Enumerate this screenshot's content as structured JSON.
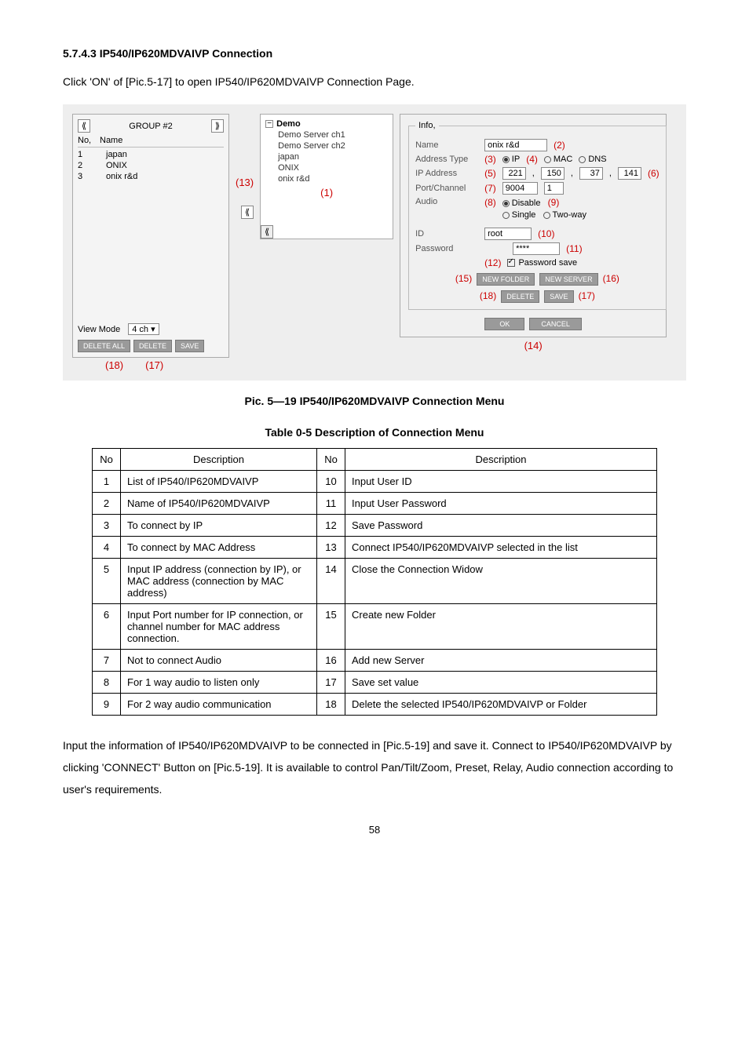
{
  "heading": "5.7.4.3 IP540/IP620MDVAIVP Connection",
  "intro": "Click 'ON' of [Pic.5-17] to open IP540/IP620MDVAIVP Connection Page.",
  "screenshot": {
    "left": {
      "groupLabel": "GROUP #2",
      "colNo": "No,",
      "colName": "Name",
      "rows": [
        {
          "no": "1",
          "name": "japan"
        },
        {
          "no": "2",
          "name": "ONIX"
        },
        {
          "no": "3",
          "name": "onix r&d"
        }
      ],
      "viewModeLabel": "View Mode",
      "viewModeValue": "4 ch",
      "btnDeleteAll": "DELETE ALL",
      "btnDelete": "DELETE",
      "btnSave": "SAVE"
    },
    "annot": {
      "n13": "(13)",
      "n1": "(1)",
      "n18": "(18)",
      "n17": "(17)",
      "n2": "(2)",
      "n3": "(3)",
      "n4": "(4)",
      "n5": "(5)",
      "n6": "(6)",
      "n7": "(7)",
      "n8": "(8)",
      "n9": "(9)",
      "n10": "(10)",
      "n11": "(11)",
      "n12": "(12)",
      "n15": "(15)",
      "n16": "(16)",
      "n14": "(14)"
    },
    "tree": {
      "root": "Demo",
      "items": [
        "Demo Server ch1",
        "Demo Server ch2",
        "japan",
        "ONIX",
        "onix r&d"
      ]
    },
    "right": {
      "legend": "Info,",
      "nameLabel": "Name",
      "nameValue": "onix r&d",
      "addrTypeLabel": "Address Type",
      "radioIP": "IP",
      "radioMAC": "MAC",
      "radioDNS": "DNS",
      "ipLabel": "IP Address",
      "ip1": "221",
      "ip2": "150",
      "ip3": "37",
      "ip4": "141",
      "portLabel": "Port/Channel",
      "portValue": "9004",
      "chValue": "1",
      "audioLabel": "Audio",
      "audioDisable": "Disable",
      "audioSingle": "Single",
      "audioTwo": "Two-way",
      "idLabel": "ID",
      "idValue": "root",
      "pwLabel": "Password",
      "pwValue": "****",
      "pwSave": "Password save",
      "btnNewFolder": "NEW FOLDER",
      "btnNewServer": "NEW SERVER",
      "btnDelete": "DELETE",
      "btnSave": "SAVE",
      "btnOk": "OK",
      "btnCancel": "CANCEL"
    }
  },
  "figCaption": "Pic. 5—19   IP540/IP620MDVAIVP   Connection Menu",
  "tableTitle": "Table 0-5 Description of Connection Menu",
  "table": {
    "hNo": "No",
    "hDesc": "Description",
    "rows": [
      {
        "n1": "1",
        "d1": "List of IP540/IP620MDVAIVP",
        "n2": "10",
        "d2": "Input User ID"
      },
      {
        "n1": "2",
        "d1": "Name of IP540/IP620MDVAIVP",
        "n2": "11",
        "d2": "Input User Password"
      },
      {
        "n1": "3",
        "d1": "To connect by IP",
        "n2": "12",
        "d2": "Save Password"
      },
      {
        "n1": "4",
        "d1": "To connect by MAC Address",
        "n2": "13",
        "d2": "Connect IP540/IP620MDVAIVP selected in the list"
      },
      {
        "n1": "5",
        "d1": "Input IP address (connection by IP), or MAC address (connection by MAC address)",
        "n2": "14",
        "d2": "Close the Connection Widow"
      },
      {
        "n1": "6",
        "d1": "Input Port number for IP connection, or channel number for MAC address connection.",
        "n2": "15",
        "d2": "Create new Folder"
      },
      {
        "n1": "7",
        "d1": "Not to connect Audio",
        "n2": "16",
        "d2": "Add new Server"
      },
      {
        "n1": "8",
        "d1": "For 1 way audio to listen only",
        "n2": "17",
        "d2": "Save set value"
      },
      {
        "n1": "9",
        "d1": "For 2 way audio communication",
        "n2": "18",
        "d2": "Delete the selected IP540/IP620MDVAIVP or Folder"
      }
    ]
  },
  "footer": "Input the information of IP540/IP620MDVAIVP to be connected in [Pic.5-19] and save it. Connect to IP540/IP620MDVAIVP by clicking 'CONNECT' Button on [Pic.5-19]. It is available to control Pan/Tilt/Zoom, Preset, Relay, Audio connection according to user's requirements.",
  "pageNum": "58"
}
